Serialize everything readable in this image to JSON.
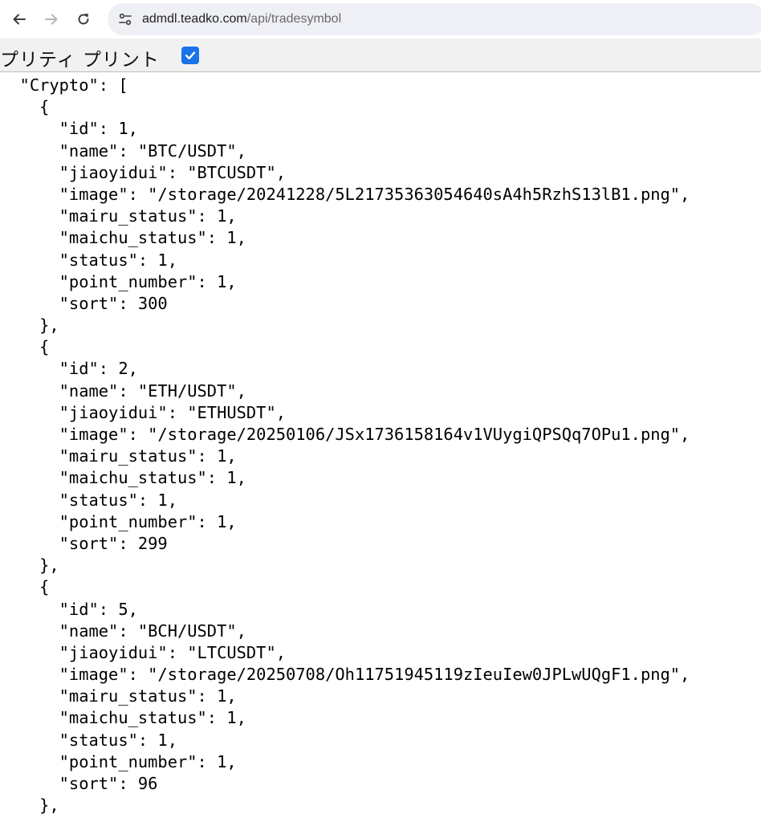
{
  "browser": {
    "url_host": "admdl.teadko.com",
    "url_path": "/api/tradesymbol"
  },
  "pretty_print": {
    "label": "プリティ プリント",
    "checked": true
  },
  "json_lines": [
    "  \"Crypto\": [",
    "    {",
    "      \"id\": 1,",
    "      \"name\": \"BTC/USDT\",",
    "      \"jiaoyidui\": \"BTCUSDT\",",
    "      \"image\": \"/storage/20241228/5L21735363054640sA4h5RzhS13lB1.png\",",
    "      \"mairu_status\": 1,",
    "      \"maichu_status\": 1,",
    "      \"status\": 1,",
    "      \"point_number\": 1,",
    "      \"sort\": 300",
    "    },",
    "    {",
    "      \"id\": 2,",
    "      \"name\": \"ETH/USDT\",",
    "      \"jiaoyidui\": \"ETHUSDT\",",
    "      \"image\": \"/storage/20250106/JSx1736158164v1VUygiQPSQq7OPu1.png\",",
    "      \"mairu_status\": 1,",
    "      \"maichu_status\": 1,",
    "      \"status\": 1,",
    "      \"point_number\": 1,",
    "      \"sort\": 299",
    "    },",
    "    {",
    "      \"id\": 5,",
    "      \"name\": \"BCH/USDT\",",
    "      \"jiaoyidui\": \"LTCUSDT\",",
    "      \"image\": \"/storage/20250708/Oh11751945119zIeuIew0JPLwUQgF1.png\",",
    "      \"mairu_status\": 1,",
    "      \"maichu_status\": 1,",
    "      \"status\": 1,",
    "      \"point_number\": 1,",
    "      \"sort\": 96",
    "    },"
  ]
}
